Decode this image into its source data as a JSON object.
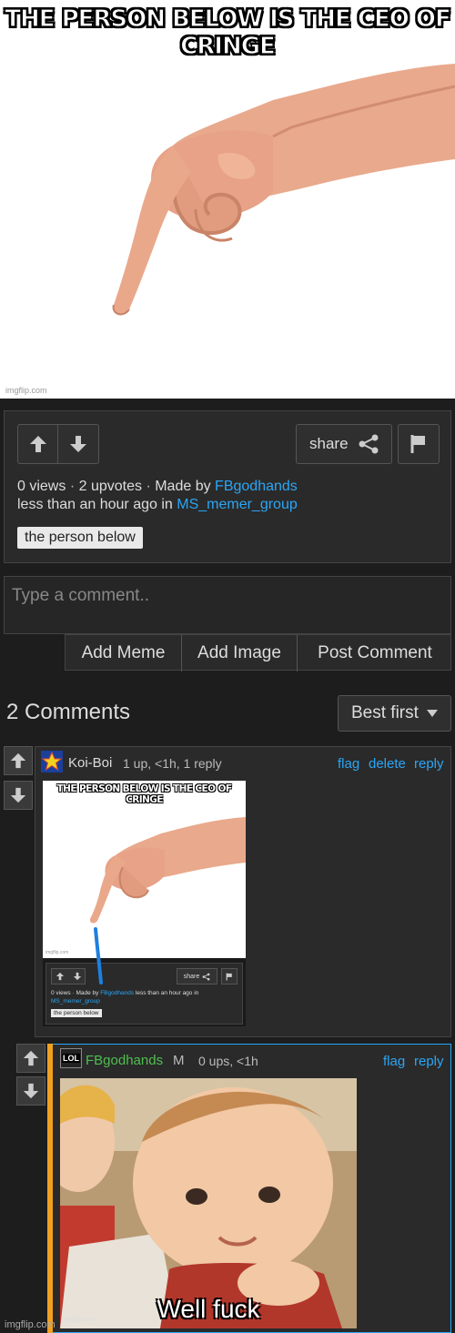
{
  "meme": {
    "caption": "THE PERSON BELOW IS THE CEO OF CRINGE",
    "watermark": "imgflip.com"
  },
  "post": {
    "share_label": "share",
    "views": "0 views",
    "upvotes": "2 upvotes",
    "made_by_prefix": "Made by",
    "author": "FBgodhands",
    "time_prefix": "less than an hour ago in",
    "group": "MS_memer_group",
    "tag": "the person below"
  },
  "comment_box": {
    "placeholder": "Type a comment..",
    "add_meme": "Add Meme",
    "add_image": "Add Image",
    "post_comment": "Post Comment"
  },
  "comments_header": {
    "count_label": "2 Comments",
    "sort_label": "Best first"
  },
  "comments": [
    {
      "username": "Koi-Boi",
      "meta": "1 up, <1h, 1 reply",
      "actions": [
        "flag",
        "delete",
        "reply"
      ],
      "image": {
        "caption": "THE PERSON BELOW IS THE CEO OF CRINGE",
        "share_label": "share",
        "meta_line": "0 views · Made by",
        "author": "FBgodhands",
        "time": "less than an hour ago in",
        "group": "MS_memer_group",
        "tag": "the person below",
        "watermark": "imgflip.com"
      }
    },
    {
      "username": "FBgodhands",
      "badge": "M",
      "meta": "0 ups, <1h",
      "actions": [
        "flag",
        "reply"
      ],
      "image": {
        "caption": "Well fuck",
        "watermark": "imgflip.com"
      }
    }
  ],
  "footer_watermark": "imgflip.com",
  "colors": {
    "accent_link": "#2aa6f5",
    "op_green": "#4fbf4f",
    "op_bar": "#f0a020"
  }
}
